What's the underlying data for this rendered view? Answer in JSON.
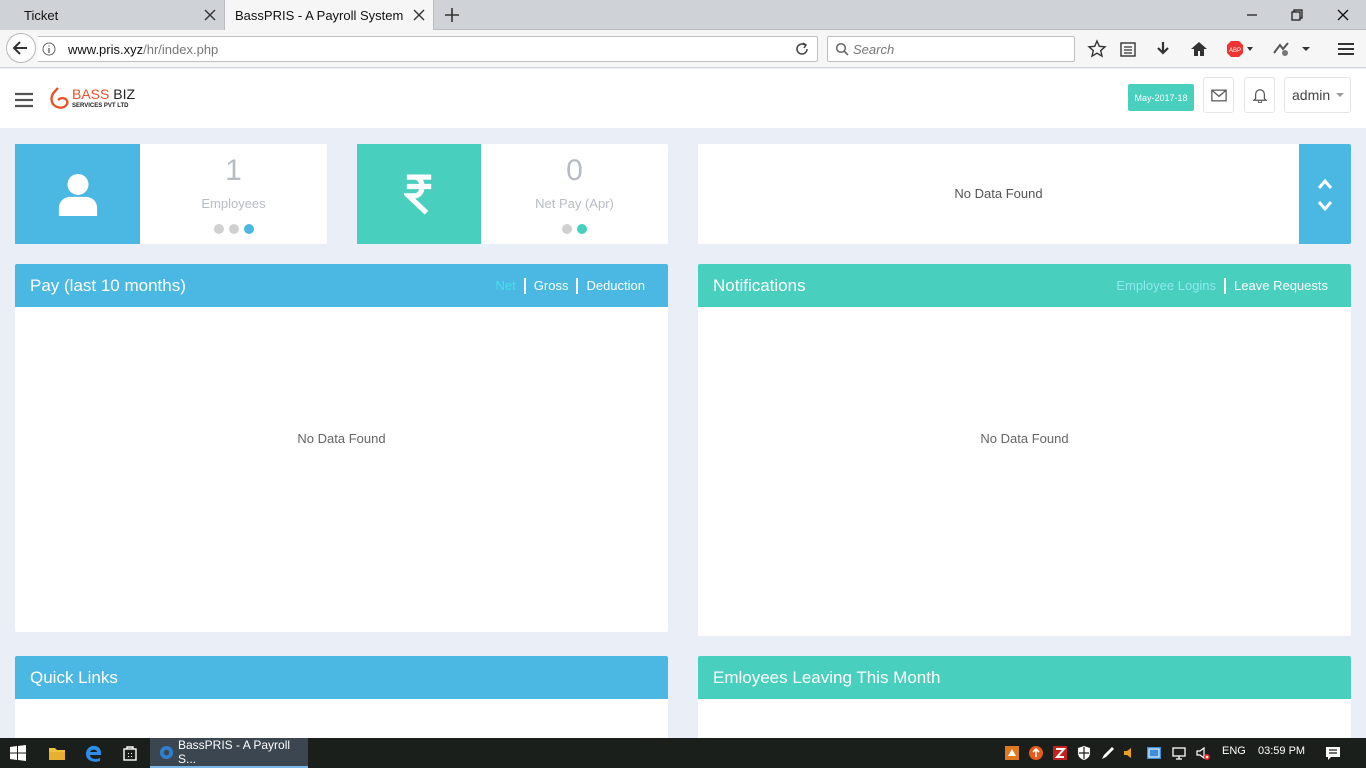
{
  "browser": {
    "tabs": [
      {
        "label": "Ticket",
        "active": false
      },
      {
        "label": "BassPRIS - A Payroll System",
        "active": true
      }
    ],
    "url_domain": "www.pris.xyz",
    "url_path": "/hr/index.php",
    "search_placeholder": "Search"
  },
  "app": {
    "logo_line1_a": "BASS",
    "logo_line1_b": "BIZ",
    "logo_line2": "SERVICES PVT LTD",
    "financial_year": "May-2017-18",
    "user": "admin"
  },
  "stats": {
    "employees": {
      "value": "1",
      "label": "Employees"
    },
    "netpay": {
      "value": "0",
      "label": "Net Pay (Apr)"
    },
    "slider": {
      "text": "No Data Found"
    }
  },
  "panels": {
    "pay": {
      "title": "Pay (last 10 months)",
      "links": [
        "Net",
        "Gross",
        "Deduction"
      ],
      "empty": "No Data Found"
    },
    "notifications": {
      "title": "Notifications",
      "links": [
        "Employee Logins",
        "Leave Requests"
      ],
      "empty": "No Data Found"
    },
    "quicklinks": {
      "title": "Quick Links"
    },
    "leaving": {
      "title": "Emloyees Leaving This Month"
    }
  },
  "taskbar": {
    "app_label": "BassPRIS - A Payroll S...",
    "language": "ENG",
    "time": "03:59 PM"
  },
  "colors": {
    "blue": "#4ab8e3",
    "teal": "#48cfbd",
    "logo_orange": "#e8522a"
  }
}
